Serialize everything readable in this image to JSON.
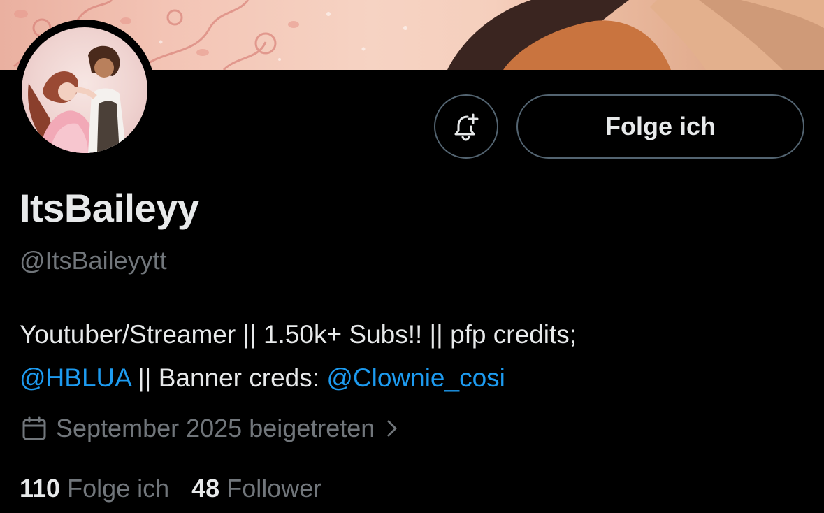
{
  "profile": {
    "display_name": "ItsBaileyy",
    "handle": "@ItsBaileyytt",
    "bio": {
      "line1": "Youtuber/Streamer || 1.50k+ Subs!! || pfp credits;",
      "mention1": "@HBLUA",
      "middle": " || Banner creds: ",
      "mention2": "@Clownie_cosi"
    },
    "joined": "September 2025 beigetreten",
    "following_count": "110",
    "following_label": "Folge ich",
    "followers_count": "48",
    "followers_label": "Follower"
  },
  "actions": {
    "follow_label": "Folge ich",
    "notify_icon": "bell-plus-icon"
  },
  "icons": {
    "joined": "calendar-icon",
    "chevron": "chevron-right-icon"
  },
  "colors": {
    "background": "#000000",
    "link": "#1d9bf0",
    "secondary_text": "#71767b",
    "border": "#536471"
  }
}
